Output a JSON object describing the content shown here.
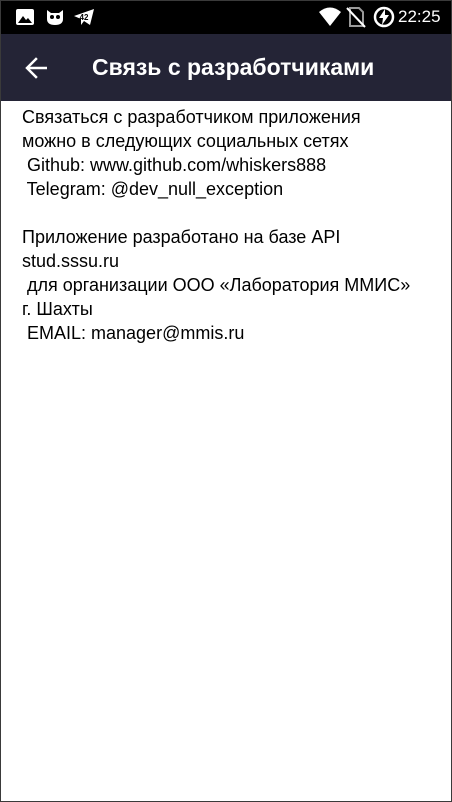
{
  "status_bar": {
    "time": "22:25",
    "notification_badge": "42",
    "icons": [
      "image-icon",
      "owl-icon",
      "telegram-icon",
      "wifi-icon",
      "no-sim-icon",
      "battery-charging-icon"
    ]
  },
  "app_bar": {
    "title": "Связь с разработчиками",
    "back_icon": "arrow-back-icon",
    "background": "#242436"
  },
  "content": {
    "paragraph_1": [
      "Связаться с разработчиком приложения",
      "можно в следующих социальных сетях",
      " Github: www.github.com/whiskers888",
      " Telegram: @dev_null_exception"
    ],
    "paragraph_2": [
      "Приложение разработано на базе API",
      "stud.sssu.ru",
      " для организации ООО «Лаборатория ММИС»",
      "г. Шахты",
      " EMAIL: manager@mmis.ru"
    ]
  }
}
